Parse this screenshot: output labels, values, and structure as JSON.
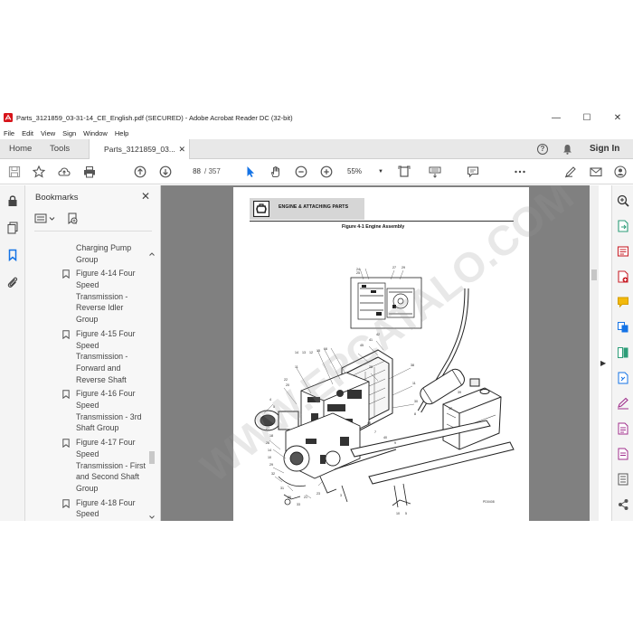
{
  "window": {
    "title": "Parts_3121859_03-31-14_CE_English.pdf (SECURED) - Adobe Acrobat Reader DC (32-bit)"
  },
  "menu": [
    "File",
    "Edit",
    "View",
    "Sign",
    "Window",
    "Help"
  ],
  "tabs": {
    "home": "Home",
    "tools": "Tools",
    "document": "Parts_3121859_03...",
    "sign_in": "Sign In"
  },
  "toolbar": {
    "current_page": "88",
    "page_count": "/ 357",
    "zoom": "55%"
  },
  "bookmarks": {
    "title": "Bookmarks",
    "items": [
      {
        "label": "Charging Pump Group",
        "lines": [
          "Charging Pump",
          "Group"
        ],
        "has_icon": false
      },
      {
        "label": "Figure 4-14 Four Speed Transmission - Reverse Idler Group",
        "lines": [
          "Figure 4-14 Four",
          "Speed",
          "Transmission -",
          "Reverse Idler",
          "Group"
        ],
        "has_icon": true
      },
      {
        "label": "Figure 4-15 Four Speed Transmission - Forward and Reverse Shaft",
        "lines": [
          "Figure 4-15 Four",
          "Speed",
          "Transmission -",
          "Forward and",
          "Reverse Shaft"
        ],
        "has_icon": true
      },
      {
        "label": "Figure 4-16 Four Speed Transmission - 3rd Shaft Group",
        "lines": [
          "Figure 4-16 Four",
          "Speed",
          "Transmission - 3rd",
          "Shaft Group"
        ],
        "has_icon": true
      },
      {
        "label": "Figure 4-17 Four Speed Transmission - First and Second Shaft Group",
        "lines": [
          "Figure 4-17 Four",
          "Speed",
          "Transmission - First",
          "and Second Shaft",
          "Group"
        ],
        "has_icon": true
      },
      {
        "label": "Figure 4-18 Four Speed",
        "lines": [
          "Figure 4-18 Four",
          "Speed"
        ],
        "has_icon": true
      }
    ]
  },
  "document": {
    "section_header": "ENGINE & ATTACHING PARTS",
    "figure_title": "Figure 4-1 Engine Assembly",
    "figure_code": "PD0408",
    "watermark": "WWW.EPCATALO.COM"
  },
  "colors": {
    "tabbar": "#e8e8e8",
    "doc_background": "#808080",
    "accent_blue": "#1473e6"
  }
}
